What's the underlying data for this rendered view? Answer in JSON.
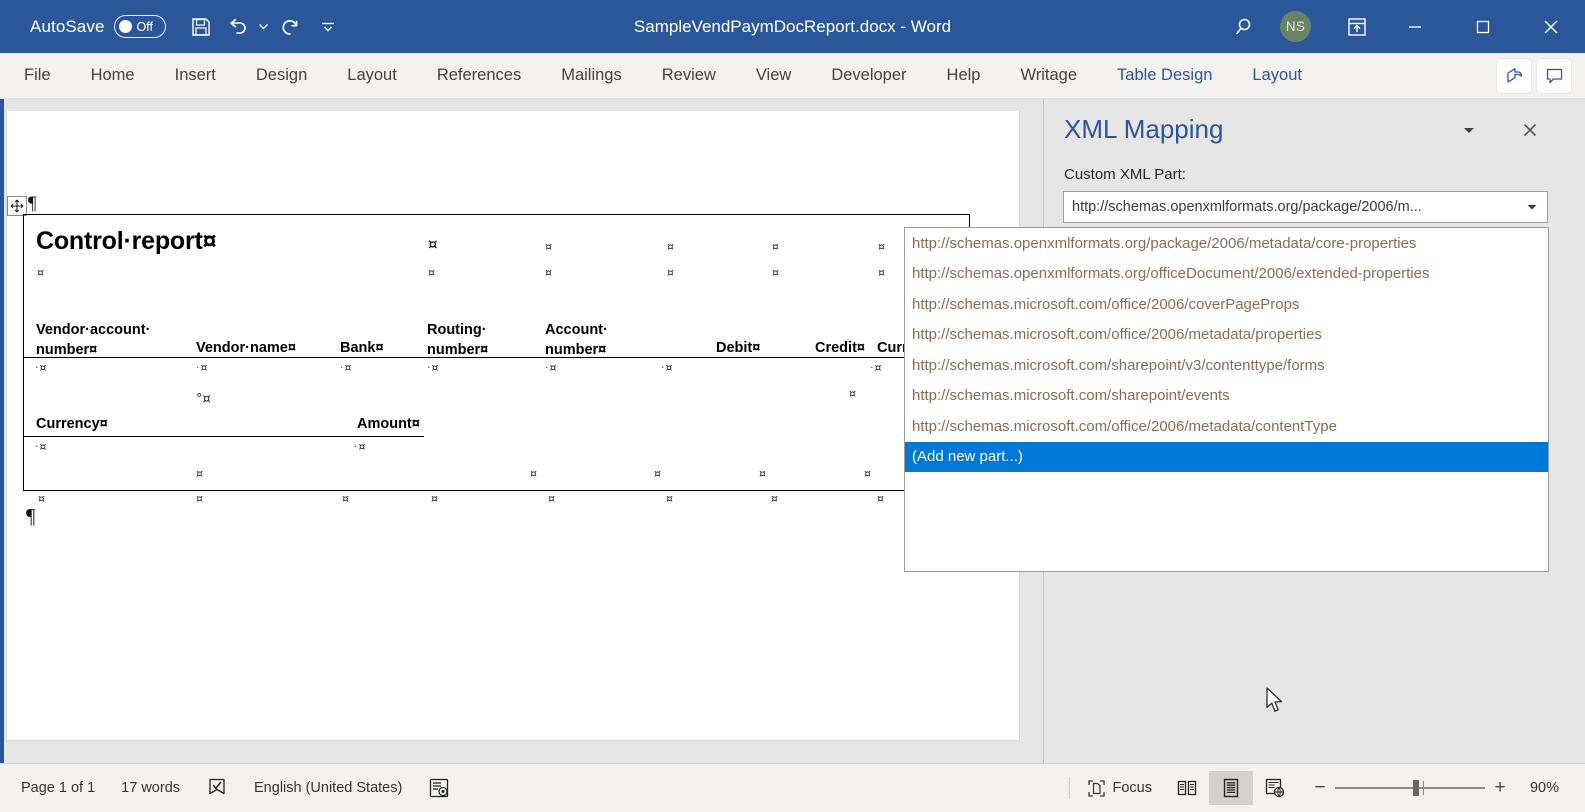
{
  "titlebar": {
    "autosave_label": "AutoSave",
    "autosave_state": "Off",
    "document_title": "SampleVendPaymDocReport.docx  -  Word",
    "avatar_initials": "NS",
    "icons": {
      "save": "save-icon",
      "undo": "undo-icon",
      "redo": "redo-icon",
      "customize_qat": "customize-quick-access-toolbar-icon",
      "search": "search-icon",
      "ribbon_display": "ribbon-display-options-icon",
      "minimize": "minimize-icon",
      "maximize": "maximize-icon",
      "close": "close-icon"
    },
    "accent_color": "#2b579a"
  },
  "ribbon": {
    "tabs": [
      {
        "label": "File",
        "contextual": false
      },
      {
        "label": "Home",
        "contextual": false
      },
      {
        "label": "Insert",
        "contextual": false
      },
      {
        "label": "Design",
        "contextual": false
      },
      {
        "label": "Layout",
        "contextual": false
      },
      {
        "label": "References",
        "contextual": false
      },
      {
        "label": "Mailings",
        "contextual": false
      },
      {
        "label": "Review",
        "contextual": false
      },
      {
        "label": "View",
        "contextual": false
      },
      {
        "label": "Developer",
        "contextual": false
      },
      {
        "label": "Help",
        "contextual": false
      },
      {
        "label": "Writage",
        "contextual": false
      },
      {
        "label": "Table Design",
        "contextual": true
      },
      {
        "label": "Layout",
        "contextual": true
      }
    ],
    "contextual_color": "#2b579a",
    "share_icon": "share-icon",
    "comments_icon": "comments-icon"
  },
  "document": {
    "title": "Control·report¤",
    "table": {
      "header_row_1": [
        "Vendor·account·\nnumber¤",
        "Vendor·name¤",
        "Bank¤",
        "Routing·\nnumber¤",
        "Account·\nnumber¤",
        "Debit¤",
        "Credit¤",
        "Curre"
      ],
      "header_row_2": [
        "Currency¤",
        "Amount¤"
      ]
    },
    "cell_marker": "¤",
    "paragraph_mark": "¶"
  },
  "taskpane": {
    "title": "XML Mapping",
    "caret_icon": "chevron-down-icon",
    "close_icon": "close-icon",
    "field_label": "Custom XML Part:",
    "combo_value": "http://schemas.openxmlformats.org/package/2006/m...",
    "combo_arrow_icon": "chevron-down-icon"
  },
  "dropdown": {
    "items": [
      {
        "label": "http://schemas.openxmlformats.org/package/2006/metadata/core-properties",
        "selected": false
      },
      {
        "label": "http://schemas.openxmlformats.org/officeDocument/2006/extended-properties",
        "selected": false
      },
      {
        "label": "http://schemas.microsoft.com/office/2006/coverPageProps",
        "selected": false
      },
      {
        "label": "http://schemas.microsoft.com/office/2006/metadata/properties",
        "selected": false
      },
      {
        "label": "http://schemas.microsoft.com/sharepoint/v3/contenttype/forms",
        "selected": false
      },
      {
        "label": "http://schemas.microsoft.com/sharepoint/events",
        "selected": false
      },
      {
        "label": "http://schemas.microsoft.com/office/2006/metadata/contentType",
        "selected": false
      },
      {
        "label": "(Add new part...)",
        "selected": true
      }
    ],
    "selection_color": "#0078d7"
  },
  "statusbar": {
    "page_info": "Page 1 of 1",
    "word_count": "17 words",
    "proofing_icon": "proofing-errors-icon",
    "language": "English (United States)",
    "accessibility_icon": "accessibility-checker-icon",
    "focus_label": "Focus",
    "focus_icon": "focus-mode-icon",
    "read_mode_icon": "read-mode-icon",
    "print_layout_icon": "print-layout-icon",
    "web_layout_icon": "web-layout-icon",
    "zoom_out_icon": "zoom-out-icon",
    "zoom_in_icon": "zoom-in-icon",
    "zoom_level": "90%"
  }
}
